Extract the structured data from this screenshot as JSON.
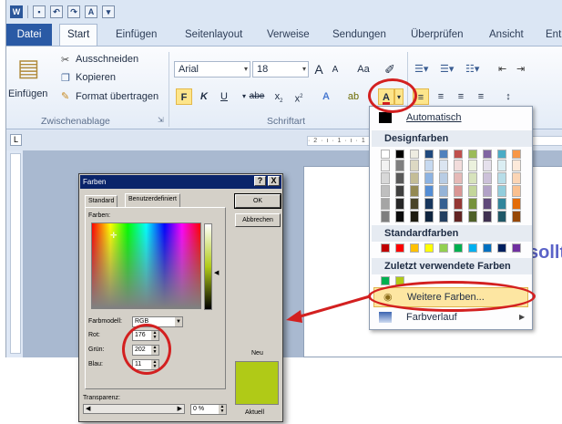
{
  "quick_access": {
    "word_icon": "word-logo-icon",
    "save_icon": "save-icon",
    "undo_icon": "undo-icon",
    "redo_icon": "redo-icon"
  },
  "tabs": [
    "Datei",
    "Start",
    "Einfügen",
    "Seitenlayout",
    "Verweise",
    "Sendungen",
    "Überprüfen",
    "Ansicht",
    "Ent"
  ],
  "clipboard": {
    "paste": "Einfügen",
    "cut": "Ausschneiden",
    "copy": "Kopieren",
    "format_painter": "Format übertragen",
    "group_label": "Zwischenablage"
  },
  "font": {
    "name": "Arial",
    "size": "18",
    "grow": "A",
    "shrink": "A",
    "case": "Aa",
    "bold": "F",
    "italic": "K",
    "underline": "U",
    "strike": "abe",
    "sub": "x",
    "sup": "x",
    "group_label": "Schriftart"
  },
  "ruler_ticks": "· 2 · ı · 1 · ı · 1 · 2 · 3 · 4 · 5 · 6",
  "document_text": "sollt",
  "color_menu": {
    "automatic": "Automatisch",
    "theme_colors_heading": "Designfarben",
    "theme_colors": [
      [
        "#ffffff",
        "#f2f2f2",
        "#d8d8d8",
        "#bfbfbf",
        "#a5a5a5",
        "#7f7f7f"
      ],
      [
        "#000000",
        "#7f7f7f",
        "#595959",
        "#3f3f3f",
        "#262626",
        "#0c0c0c"
      ],
      [
        "#eeece1",
        "#ddd9c3",
        "#c4bd97",
        "#938953",
        "#494429",
        "#1d1b10"
      ],
      [
        "#1f497d",
        "#c6d9f0",
        "#8db3e2",
        "#548dd4",
        "#17365d",
        "#0f243e"
      ],
      [
        "#4f81bd",
        "#dbe5f1",
        "#b8cce4",
        "#95b3d7",
        "#366092",
        "#244061"
      ],
      [
        "#c0504d",
        "#f2dcdb",
        "#e5b9b7",
        "#d99694",
        "#953734",
        "#632423"
      ],
      [
        "#9bbb59",
        "#ebf1dd",
        "#d7e3bc",
        "#c3d69b",
        "#76923c",
        "#4f6128"
      ],
      [
        "#8064a2",
        "#e5e0ec",
        "#ccc1d9",
        "#b2a2c7",
        "#5f497a",
        "#3f3151"
      ],
      [
        "#4bacc6",
        "#dbeef3",
        "#b7dde8",
        "#92cddc",
        "#31859b",
        "#205867"
      ],
      [
        "#f79646",
        "#fdeada",
        "#fbd5b5",
        "#fac08f",
        "#e36c09",
        "#974806"
      ]
    ],
    "standard_colors_heading": "Standardfarben",
    "standard_colors": [
      "#c00000",
      "#ff0000",
      "#ffc000",
      "#ffff00",
      "#92d050",
      "#00b050",
      "#00b0f0",
      "#0070c0",
      "#002060",
      "#7030a0"
    ],
    "recent_heading": "Zuletzt verwendete Farben",
    "recent_colors": [
      "#00b050",
      "#b0ca17"
    ],
    "more_colors": "Weitere Farben...",
    "gradient": "Farbverlauf"
  },
  "dialog": {
    "title": "Farben",
    "help": "?",
    "close": "X",
    "tab_standard": "Standard",
    "tab_custom": "Benutzerdefiniert",
    "colors_label": "Farben:",
    "ok": "OK",
    "cancel": "Abbrechen",
    "color_model_label": "Farbmodell:",
    "color_model": "RGB",
    "red_label": "Rot:",
    "red": "176",
    "green_label": "Grün:",
    "green": "202",
    "blue_label": "Blau:",
    "blue": "11",
    "new_label": "Neu",
    "current_label": "Aktuell",
    "transparency_label": "Transparenz:",
    "transparency": "0 %",
    "new_color": "#b0ca17"
  },
  "accent": {
    "highlight": "#fde58b",
    "annotation": "#d32020",
    "file_tab": "#2a5aa5"
  }
}
